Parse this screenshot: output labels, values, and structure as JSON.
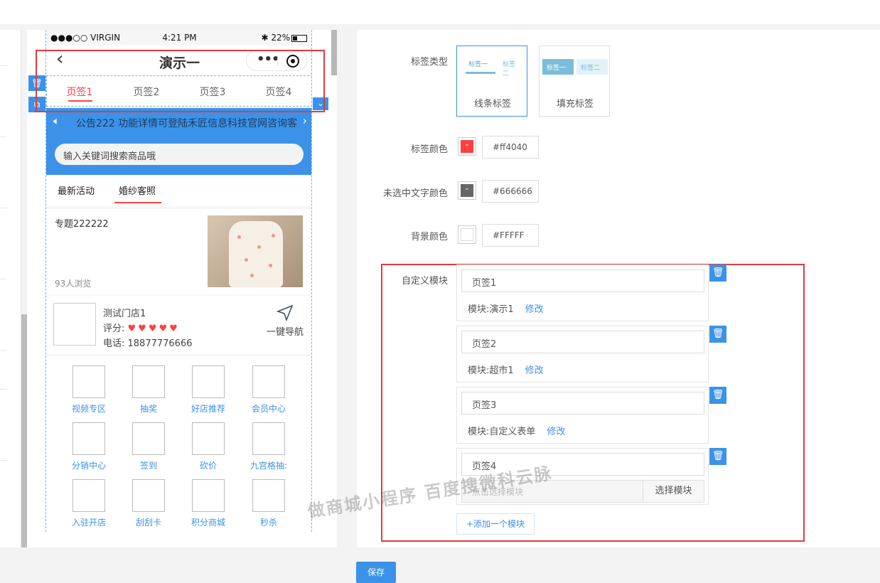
{
  "status": {
    "carrier": "●●●○○ VIRGIN",
    "time": "4:21 PM",
    "battery": "22%"
  },
  "nav": {
    "title": "演示一"
  },
  "tabs": [
    {
      "label": "页签1",
      "active": true
    },
    {
      "label": "页签2",
      "active": false
    },
    {
      "label": "页签3",
      "active": false
    },
    {
      "label": "页签4",
      "active": false
    }
  ],
  "notice": {
    "text": "公告222  功能详情可登陆禾匠信息科技官网咨询客"
  },
  "search": {
    "placeholder": "输入关键词搜索商品哦"
  },
  "categories": [
    "最新活动",
    "婚纱客照"
  ],
  "topic": {
    "title": "专题222222",
    "views": "93人浏览"
  },
  "store": {
    "name": "测试门店1",
    "rating_label": "评分:",
    "rating_stars": 5,
    "phone": "电话: 18877776666",
    "nav_label": "一键导航"
  },
  "grid_items": [
    "视频专区",
    "抽奖",
    "好店推荐",
    "会员中心",
    "分销中心",
    "签到",
    "砍价",
    "九宫格抽:",
    "入驻开店",
    "刮刮卡",
    "积分商城",
    "秒杀"
  ],
  "settings": {
    "tag_type_label": "标签类型",
    "tag_types": [
      {
        "name": "线条标签",
        "preview": [
          "标签一",
          "标签二"
        ],
        "selected": true
      },
      {
        "name": "填充标签",
        "preview": [
          "标签一",
          "标签二"
        ],
        "selected": false
      }
    ],
    "tag_color": {
      "label": "标签颜色",
      "value": "#ff4040",
      "swatch": "#ff4040"
    },
    "unselected_color": {
      "label": "未选中文字颜色",
      "value": "#666666",
      "swatch": "#666666"
    },
    "bg_color": {
      "label": "背景颜色",
      "value": "#FFFFF",
      "swatch": "#ffffff"
    },
    "custom_label": "自定义模块",
    "modules": [
      {
        "name": "页签1",
        "module_label": "模块:",
        "module": "演示1",
        "edit": "修改"
      },
      {
        "name": "页签2",
        "module_label": "模块:",
        "module": "超市1",
        "edit": "修改"
      },
      {
        "name": "页签3",
        "module_label": "模块:",
        "module": "自定义表单",
        "edit": "修改"
      },
      {
        "name": "页签4",
        "select_placeholder": "点击选择模块",
        "select_button": "选择模块"
      }
    ],
    "add_module": "+添加一个模块"
  },
  "watermark": "做商城小程序 百度搜微科云脉",
  "save": "保存",
  "colors": {
    "accent": "#3b92e8",
    "tag": "#ff4040",
    "highlight_border": "#e23b3b"
  }
}
